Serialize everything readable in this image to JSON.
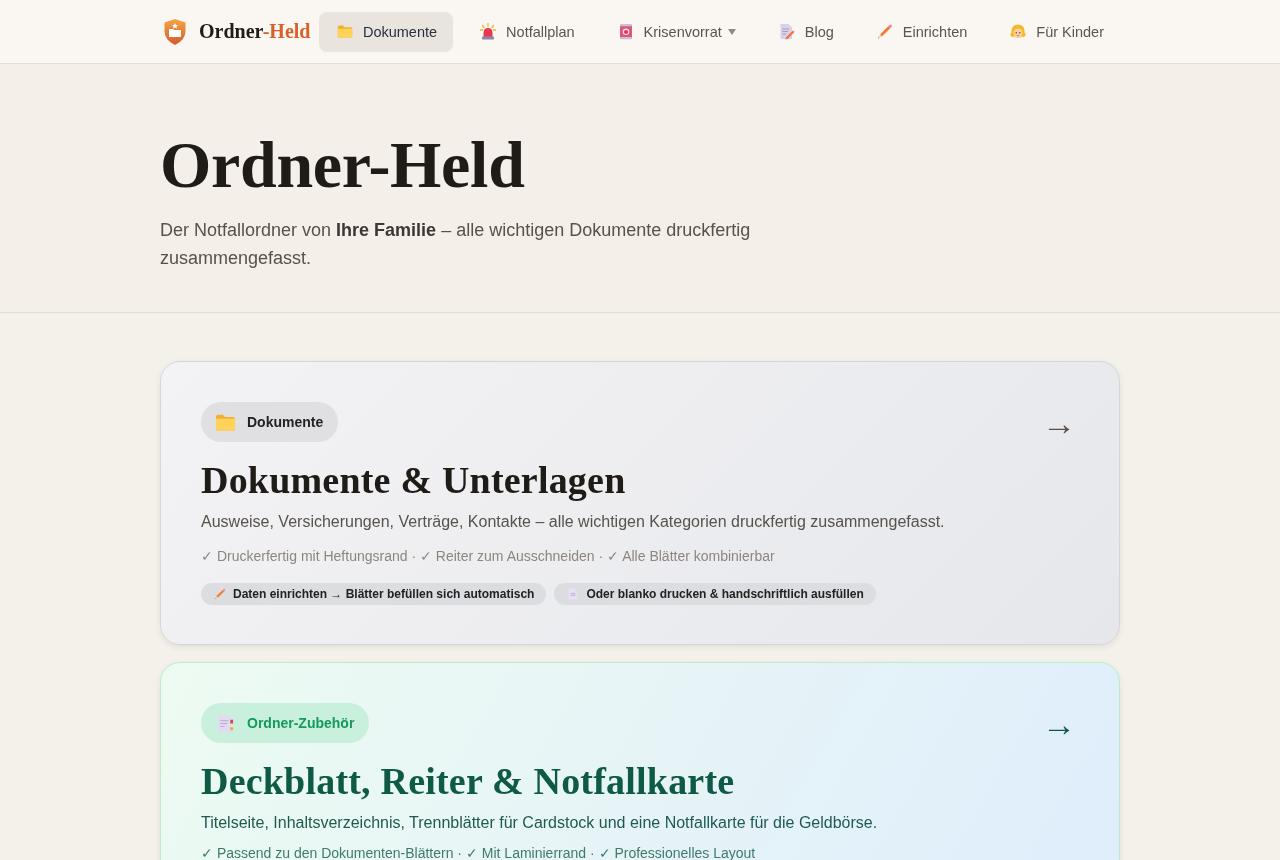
{
  "header": {
    "brand": {
      "name": "Ordner",
      "accent": "-Held"
    },
    "nav": [
      {
        "label": "Dokumente",
        "selected": true,
        "dropdown": false
      },
      {
        "label": "Notfallplan",
        "selected": false,
        "dropdown": false
      },
      {
        "label": "Krisenvorrat",
        "selected": false,
        "dropdown": true
      },
      {
        "label": "Blog",
        "selected": false,
        "dropdown": false
      },
      {
        "label": "Einrichten",
        "selected": false,
        "dropdown": false
      },
      {
        "label": "Für Kinder",
        "selected": false,
        "dropdown": false
      }
    ]
  },
  "hero": {
    "title": "Ordner-Held",
    "subtitle": "Der Notfallordner von **Ihre Familie** – alle wichtigen Dokumente druckfertig zusammengefasst."
  },
  "cards": [
    {
      "kind": "documents",
      "badge": "Dokumente",
      "arrow": "→",
      "title": "Dokumente & Unterlagen",
      "description": "Ausweise, Versicherungen, Verträge, Kontakte – alle wichtigen Kategorien druckfertig zusammengefasst.",
      "features": "✓ Druckerfertig mit Heftungsrand · ✓ Reiter zum Ausschneiden · ✓ Alle Blätter kombinierbar",
      "chips": [
        {
          "text": "Daten einrichten → Blätter befüllen sich automatisch"
        },
        {
          "text": "Oder blanko drucken & handschriftlich ausfüllen"
        }
      ]
    },
    {
      "kind": "accessories",
      "badge": "Ordner-Zubehör",
      "arrow": "→",
      "title": "Deckblatt, Reiter & Notfallkarte",
      "description": "Titelseite, Inhaltsverzeichnis, Trennblätter für Cardstock und eine Notfallkarte für die Geldbörse.",
      "features": "✓ Passend zu den Dokumenten-Blättern · ✓ Mit Laminierrand · ✓ Professionelles Layout"
    }
  ]
}
